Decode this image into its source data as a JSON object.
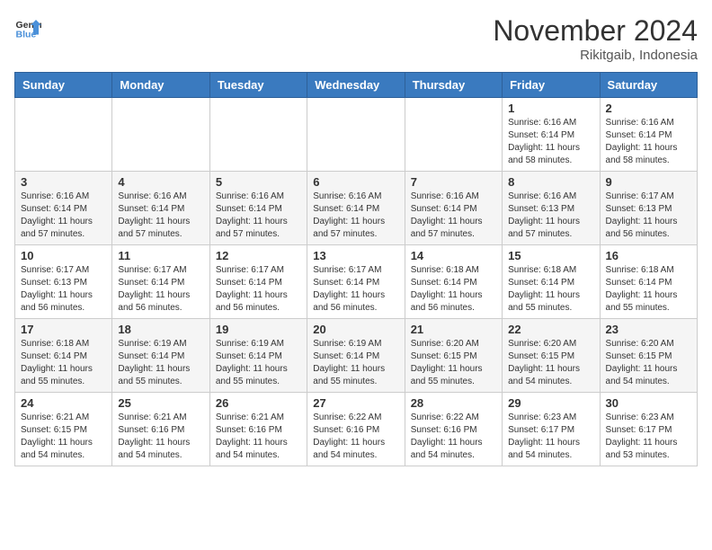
{
  "logo": {
    "line1": "General",
    "line2": "Blue"
  },
  "title": "November 2024",
  "subtitle": "Rikitgaib, Indonesia",
  "headers": [
    "Sunday",
    "Monday",
    "Tuesday",
    "Wednesday",
    "Thursday",
    "Friday",
    "Saturday"
  ],
  "weeks": [
    [
      {
        "day": "",
        "info": ""
      },
      {
        "day": "",
        "info": ""
      },
      {
        "day": "",
        "info": ""
      },
      {
        "day": "",
        "info": ""
      },
      {
        "day": "",
        "info": ""
      },
      {
        "day": "1",
        "info": "Sunrise: 6:16 AM\nSunset: 6:14 PM\nDaylight: 11 hours\nand 58 minutes."
      },
      {
        "day": "2",
        "info": "Sunrise: 6:16 AM\nSunset: 6:14 PM\nDaylight: 11 hours\nand 58 minutes."
      }
    ],
    [
      {
        "day": "3",
        "info": "Sunrise: 6:16 AM\nSunset: 6:14 PM\nDaylight: 11 hours\nand 57 minutes."
      },
      {
        "day": "4",
        "info": "Sunrise: 6:16 AM\nSunset: 6:14 PM\nDaylight: 11 hours\nand 57 minutes."
      },
      {
        "day": "5",
        "info": "Sunrise: 6:16 AM\nSunset: 6:14 PM\nDaylight: 11 hours\nand 57 minutes."
      },
      {
        "day": "6",
        "info": "Sunrise: 6:16 AM\nSunset: 6:14 PM\nDaylight: 11 hours\nand 57 minutes."
      },
      {
        "day": "7",
        "info": "Sunrise: 6:16 AM\nSunset: 6:14 PM\nDaylight: 11 hours\nand 57 minutes."
      },
      {
        "day": "8",
        "info": "Sunrise: 6:16 AM\nSunset: 6:13 PM\nDaylight: 11 hours\nand 57 minutes."
      },
      {
        "day": "9",
        "info": "Sunrise: 6:17 AM\nSunset: 6:13 PM\nDaylight: 11 hours\nand 56 minutes."
      }
    ],
    [
      {
        "day": "10",
        "info": "Sunrise: 6:17 AM\nSunset: 6:13 PM\nDaylight: 11 hours\nand 56 minutes."
      },
      {
        "day": "11",
        "info": "Sunrise: 6:17 AM\nSunset: 6:14 PM\nDaylight: 11 hours\nand 56 minutes."
      },
      {
        "day": "12",
        "info": "Sunrise: 6:17 AM\nSunset: 6:14 PM\nDaylight: 11 hours\nand 56 minutes."
      },
      {
        "day": "13",
        "info": "Sunrise: 6:17 AM\nSunset: 6:14 PM\nDaylight: 11 hours\nand 56 minutes."
      },
      {
        "day": "14",
        "info": "Sunrise: 6:18 AM\nSunset: 6:14 PM\nDaylight: 11 hours\nand 56 minutes."
      },
      {
        "day": "15",
        "info": "Sunrise: 6:18 AM\nSunset: 6:14 PM\nDaylight: 11 hours\nand 55 minutes."
      },
      {
        "day": "16",
        "info": "Sunrise: 6:18 AM\nSunset: 6:14 PM\nDaylight: 11 hours\nand 55 minutes."
      }
    ],
    [
      {
        "day": "17",
        "info": "Sunrise: 6:18 AM\nSunset: 6:14 PM\nDaylight: 11 hours\nand 55 minutes."
      },
      {
        "day": "18",
        "info": "Sunrise: 6:19 AM\nSunset: 6:14 PM\nDaylight: 11 hours\nand 55 minutes."
      },
      {
        "day": "19",
        "info": "Sunrise: 6:19 AM\nSunset: 6:14 PM\nDaylight: 11 hours\nand 55 minutes."
      },
      {
        "day": "20",
        "info": "Sunrise: 6:19 AM\nSunset: 6:14 PM\nDaylight: 11 hours\nand 55 minutes."
      },
      {
        "day": "21",
        "info": "Sunrise: 6:20 AM\nSunset: 6:15 PM\nDaylight: 11 hours\nand 55 minutes."
      },
      {
        "day": "22",
        "info": "Sunrise: 6:20 AM\nSunset: 6:15 PM\nDaylight: 11 hours\nand 54 minutes."
      },
      {
        "day": "23",
        "info": "Sunrise: 6:20 AM\nSunset: 6:15 PM\nDaylight: 11 hours\nand 54 minutes."
      }
    ],
    [
      {
        "day": "24",
        "info": "Sunrise: 6:21 AM\nSunset: 6:15 PM\nDaylight: 11 hours\nand 54 minutes."
      },
      {
        "day": "25",
        "info": "Sunrise: 6:21 AM\nSunset: 6:16 PM\nDaylight: 11 hours\nand 54 minutes."
      },
      {
        "day": "26",
        "info": "Sunrise: 6:21 AM\nSunset: 6:16 PM\nDaylight: 11 hours\nand 54 minutes."
      },
      {
        "day": "27",
        "info": "Sunrise: 6:22 AM\nSunset: 6:16 PM\nDaylight: 11 hours\nand 54 minutes."
      },
      {
        "day": "28",
        "info": "Sunrise: 6:22 AM\nSunset: 6:16 PM\nDaylight: 11 hours\nand 54 minutes."
      },
      {
        "day": "29",
        "info": "Sunrise: 6:23 AM\nSunset: 6:17 PM\nDaylight: 11 hours\nand 54 minutes."
      },
      {
        "day": "30",
        "info": "Sunrise: 6:23 AM\nSunset: 6:17 PM\nDaylight: 11 hours\nand 53 minutes."
      }
    ]
  ]
}
